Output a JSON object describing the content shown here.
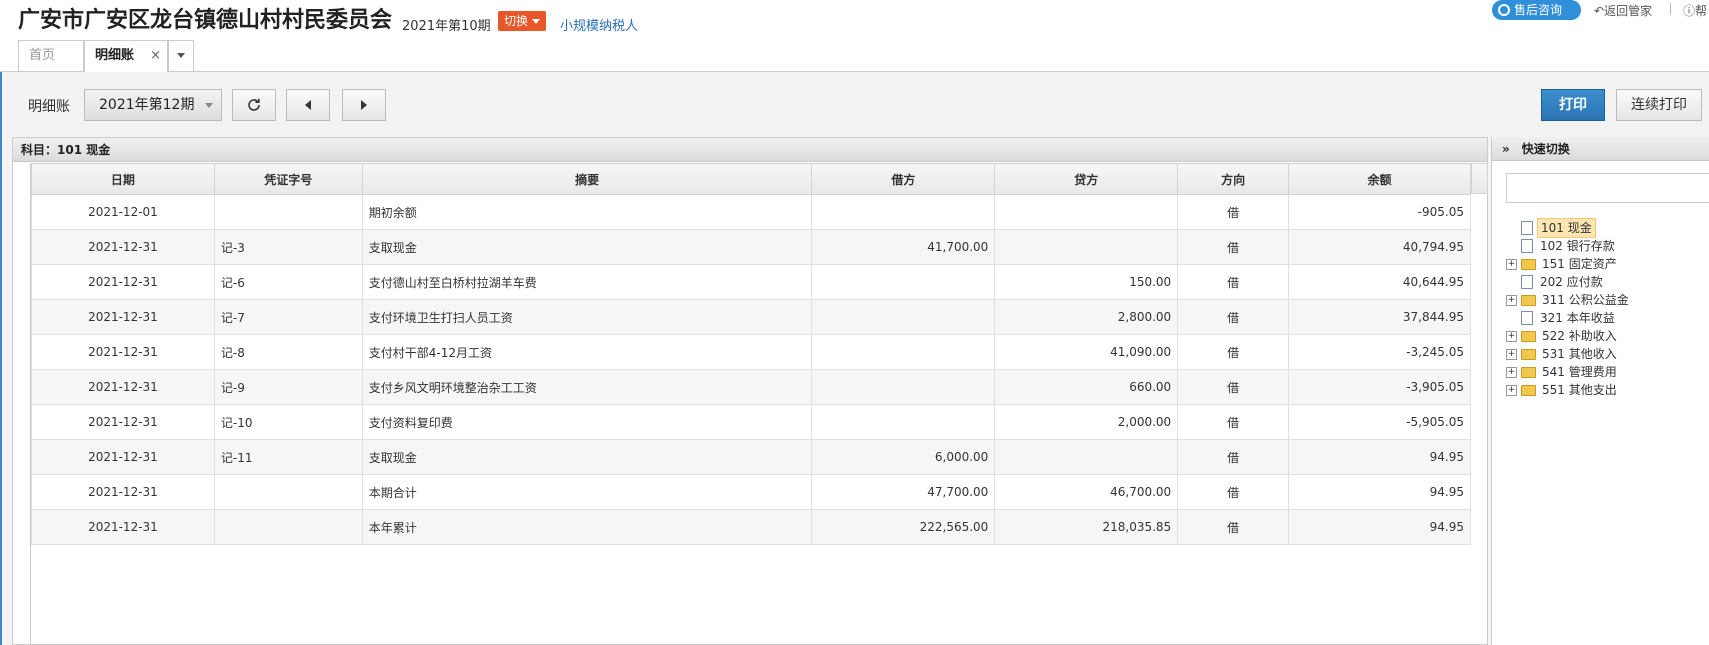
{
  "header": {
    "company": "广安市广安区龙台镇德山村村民委员会",
    "period": "2021年第10期",
    "switch_label": "切换",
    "taxpayer": "小规模纳税人",
    "support_label": "售后咨询",
    "back_label": "返回管家",
    "help_label": "帮"
  },
  "tabs": [
    {
      "label": "首页"
    },
    {
      "label": "明细账",
      "close": "×"
    }
  ],
  "toolbar": {
    "label": "明细账",
    "period_value": "2021年第12期",
    "print_label": "打印",
    "continuous_print_label": "连续打印"
  },
  "subject": "科目：101  现金",
  "table": {
    "columns": [
      "日期",
      "凭证字号",
      "摘要",
      "借方",
      "贷方",
      "方向",
      "余额"
    ],
    "rows": [
      [
        "2021-12-01",
        "",
        "期初余额",
        "",
        "",
        "借",
        "-905.05"
      ],
      [
        "2021-12-31",
        "记-3",
        "支取现金",
        "41,700.00",
        "",
        "借",
        "40,794.95"
      ],
      [
        "2021-12-31",
        "记-6",
        "支付德山村至白桥村拉湖羊车费",
        "",
        "150.00",
        "借",
        "40,644.95"
      ],
      [
        "2021-12-31",
        "记-7",
        "支付环境卫生打扫人员工资",
        "",
        "2,800.00",
        "借",
        "37,844.95"
      ],
      [
        "2021-12-31",
        "记-8",
        "支付村干部4-12月工资",
        "",
        "41,090.00",
        "借",
        "-3,245.05"
      ],
      [
        "2021-12-31",
        "记-9",
        "支付乡风文明环境整治杂工工资",
        "",
        "660.00",
        "借",
        "-3,905.05"
      ],
      [
        "2021-12-31",
        "记-10",
        "支付资料复印费",
        "",
        "2,000.00",
        "借",
        "-5,905.05"
      ],
      [
        "2021-12-31",
        "记-11",
        "支取现金",
        "6,000.00",
        "",
        "借",
        "94.95"
      ],
      [
        "2021-12-31",
        "",
        "本期合计",
        "47,700.00",
        "46,700.00",
        "借",
        "94.95"
      ],
      [
        "2021-12-31",
        "",
        "本年累计",
        "222,565.00",
        "218,035.85",
        "借",
        "94.95"
      ]
    ]
  },
  "side": {
    "chevron": "»",
    "title": "快速切换",
    "tree": [
      {
        "label": "101 现金",
        "kind": "file",
        "expandable": false,
        "selected": true
      },
      {
        "label": "102 银行存款",
        "kind": "file",
        "expandable": false,
        "selected": false
      },
      {
        "label": "151 固定资产",
        "kind": "folder",
        "expandable": true,
        "selected": false
      },
      {
        "label": "202 应付款",
        "kind": "file",
        "expandable": false,
        "selected": false
      },
      {
        "label": "311 公积公益金",
        "kind": "folder",
        "expandable": true,
        "selected": false
      },
      {
        "label": "321 本年收益",
        "kind": "file",
        "expandable": false,
        "selected": false
      },
      {
        "label": "522 补助收入",
        "kind": "folder",
        "expandable": true,
        "selected": false
      },
      {
        "label": "531 其他收入",
        "kind": "folder",
        "expandable": true,
        "selected": false
      },
      {
        "label": "541 管理费用",
        "kind": "folder",
        "expandable": true,
        "selected": false
      },
      {
        "label": "551 其他支出",
        "kind": "folder",
        "expandable": true,
        "selected": false
      }
    ]
  },
  "icons": {
    "refresh": "refresh-icon",
    "prev": "triangle-left-icon",
    "next": "triangle-right-icon",
    "support": "headset-icon",
    "back": "return-arrow-icon",
    "help": "question-icon"
  },
  "colors": {
    "accent": "#2f8fd8",
    "switch": "#e8562a",
    "print": "#2a73b2",
    "taxpayer_link": "#2a6fb5"
  }
}
